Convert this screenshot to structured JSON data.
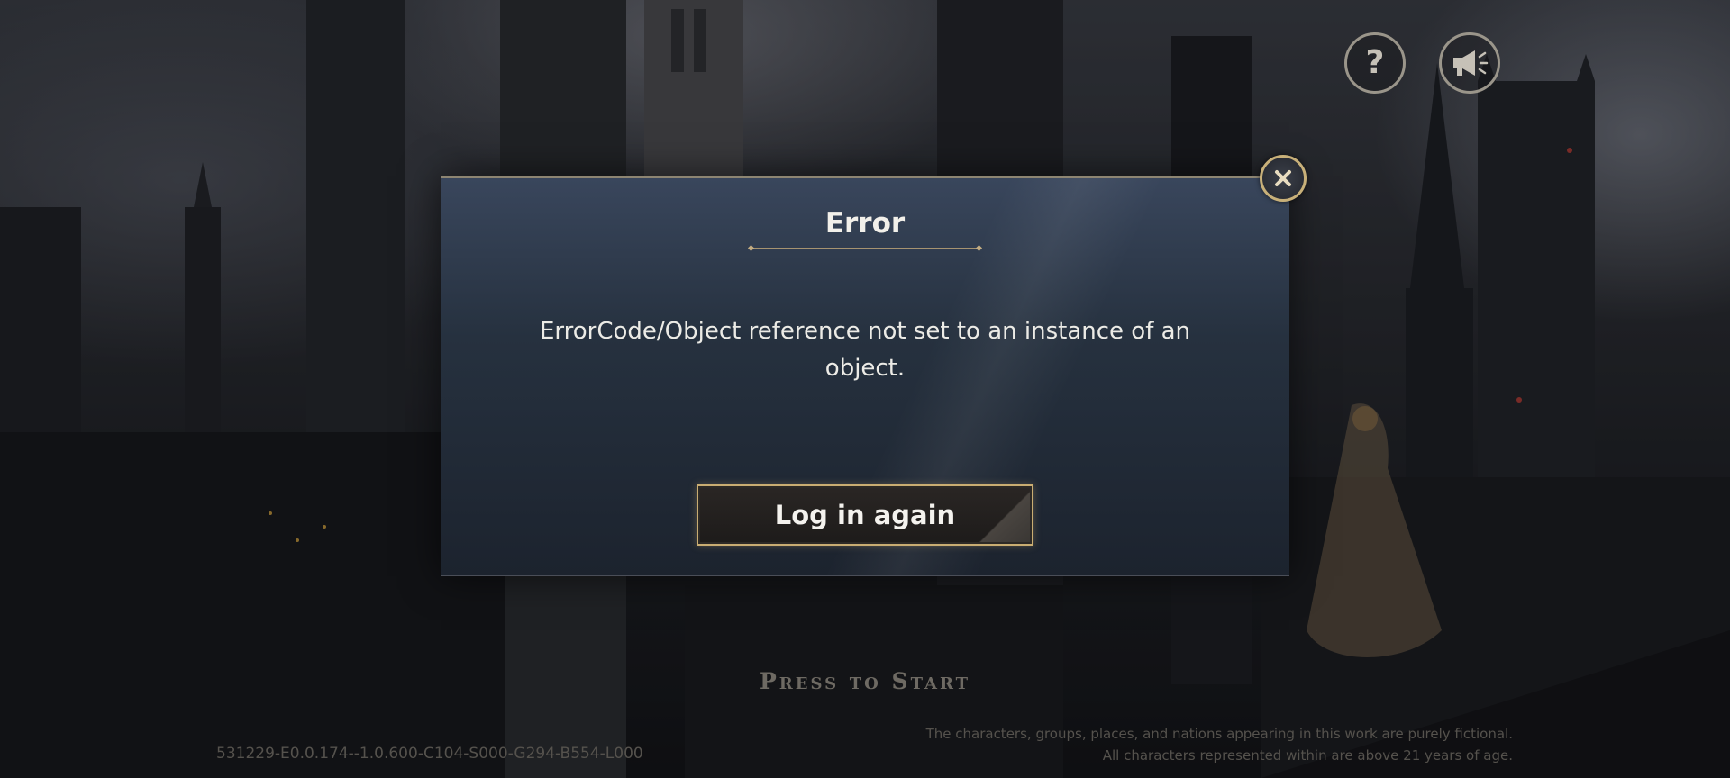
{
  "top_icons": {
    "help_glyph": "?"
  },
  "dialog": {
    "title": "Error",
    "message": "ErrorCode/Object reference not set to an instance of an object.",
    "button_label": "Log in again"
  },
  "footer": {
    "press_to_start": "Press to Start",
    "version": "531229-E0.0.174--1.0.600-C104-S000-G294-B554-L000",
    "disclaimer_line1": "The characters, groups, places, and nations appearing in this work are purely fictional.",
    "disclaimer_line2": "All characters represented within are above 21 years of age."
  },
  "colors": {
    "accent_gold": "#c9ad72",
    "dialog_bg": "#26313f",
    "text_light": "#f2f0ea"
  }
}
